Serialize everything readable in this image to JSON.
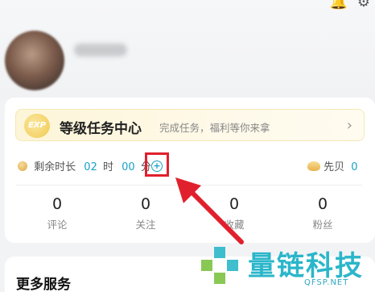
{
  "header": {
    "icons": [
      "bell-icon",
      "gear-icon"
    ],
    "nickname": ""
  },
  "level_banner": {
    "title": "等级任务中心",
    "subtitle": "完成任务，福利等你来拿",
    "badge": "EXP"
  },
  "timer": {
    "label": "剩余时长",
    "hours": "02",
    "hours_unit": "时",
    "minutes": "00",
    "minutes_unit": "分",
    "add_symbol": "+"
  },
  "xianbei": {
    "label": "先贝",
    "value": "0"
  },
  "stats": [
    {
      "value": "0",
      "label": "评论"
    },
    {
      "value": "0",
      "label": "关注"
    },
    {
      "value": "0",
      "label": "收藏"
    },
    {
      "value": "0",
      "label": "粉丝"
    }
  ],
  "more_services": {
    "title": "更多服务"
  },
  "watermark": {
    "cn": "量链科技",
    "en": "QFSP.NET"
  },
  "colors": {
    "accent": "#1ba1c6",
    "highlight": "#e1202d",
    "banner": "#fdf5d8"
  }
}
